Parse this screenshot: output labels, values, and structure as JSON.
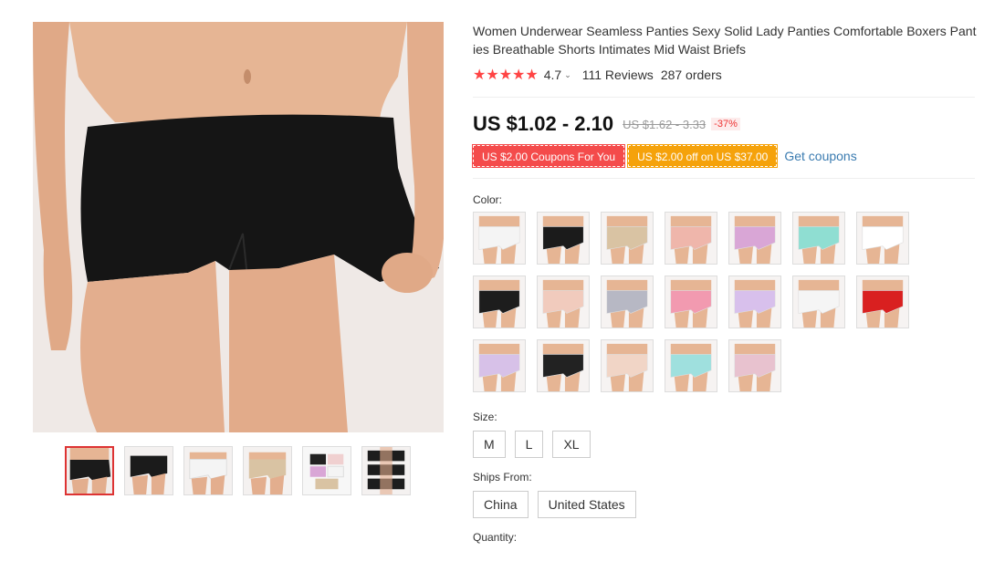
{
  "product": {
    "title": "Women Underwear Seamless Panties Sexy Solid Lady Panties Comfortable Boxers Panties Breathable Shorts Intimates Mid Waist Briefs",
    "stars": "★★★★★",
    "rating": "4.7",
    "reviews": "111 Reviews",
    "orders": "287 orders",
    "price": "US $1.02 - 2.10",
    "old_price": "US $1.62 - 3.33",
    "discount": "-37%"
  },
  "coupons": {
    "coupon1": "US $2.00 Coupons For You",
    "coupon2": "US $2.00 off on US $37.00",
    "get_coupons": "Get coupons"
  },
  "labels": {
    "color": "Color:",
    "size": "Size:",
    "ships_from": "Ships From:",
    "quantity": "Quantity:"
  },
  "sizes": [
    "M",
    "L",
    "XL"
  ],
  "ships_from": [
    "China",
    "United States"
  ],
  "colors": {
    "swatches": [
      "#f4f4f4",
      "#1b1b1b",
      "#d9c3a3",
      "#efb6ab",
      "#d9a6d6",
      "#8fded2",
      "#ffffff",
      "#1d1d1d",
      "#f1cbbd",
      "#b7b8c4",
      "#f29ab0",
      "#d8c0ec",
      "#f5f5f5",
      "#d92020",
      "#d7c1e8",
      "#222222",
      "#f1d5c6",
      "#9fe0de",
      "#e8c2cf"
    ],
    "thumbs": [
      "#1b1b1b",
      "#1b1b1b",
      "#f4f4f4",
      "#d9c3a3",
      "#eeeeee",
      "#1d1d1d"
    ],
    "accent": "#d33"
  }
}
